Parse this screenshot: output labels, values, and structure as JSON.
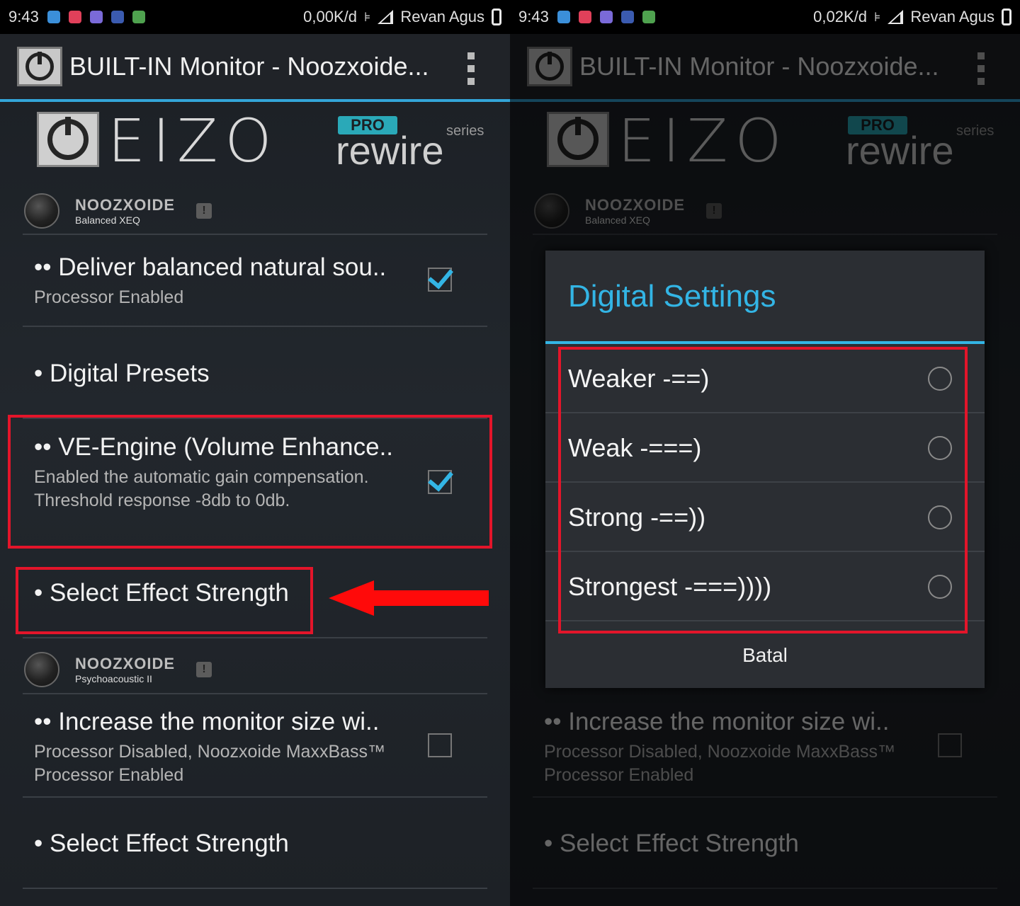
{
  "status_left": {
    "time": "9:43",
    "speed": "0,00K/d",
    "carrier": "Revan Agus",
    "icons": [
      "browser-icon",
      "music-icon",
      "gallery-icon",
      "facebook-icon",
      "app-icon"
    ]
  },
  "status_right": {
    "time": "9:43",
    "speed": "0,02K/d",
    "carrier": "Revan Agus"
  },
  "actionbar": {
    "title": "BUILT-IN Monitor - Noozxoide..."
  },
  "banner": {
    "brand": "EIZO",
    "pro": "PRO",
    "series": "series",
    "product": "rewire"
  },
  "category1": {
    "brand": "NOOZXOIDE",
    "sub": "Balanced XEQ",
    "warn": "!"
  },
  "category2": {
    "brand": "NOOZXOIDE",
    "sub": "Psychoacoustic II",
    "warn": "!"
  },
  "prefs": {
    "balanced": {
      "title": "•• Deliver balanced natural sou..",
      "summary": "Processor Enabled",
      "checked": true
    },
    "presets": {
      "title": "• Digital Presets"
    },
    "ve_engine": {
      "title": "•• VE-Engine (Volume Enhance..",
      "summary": "Enabled the automatic gain compensation. Threshold response -8db to 0db.",
      "checked": true
    },
    "effect_strength_1": {
      "title": "• Select Effect Strength"
    },
    "monitor_size": {
      "title": "•• Increase the monitor size wi..",
      "summary": "Processor Disabled, Noozxoide MaxxBass™ Processor Enabled",
      "checked": false
    },
    "effect_strength_2": {
      "title": "• Select Effect Strength"
    }
  },
  "dialog": {
    "title": "Digital Settings",
    "options": [
      "Weaker -==)",
      "Weak -===)",
      "Strong -==))",
      "Strongest -===))))"
    ],
    "cancel": "Batal"
  },
  "colors": {
    "accent": "#33b5e5",
    "highlight": "#e3152a",
    "arrow": "#ff0a0a"
  }
}
